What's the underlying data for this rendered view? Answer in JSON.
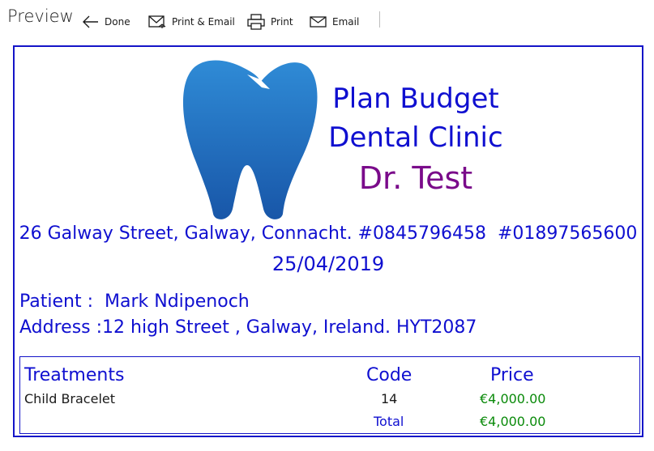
{
  "toolbar": {
    "title": "Preview",
    "done_label": "Done",
    "print_email_label": "Print & Email",
    "print_label": "Print",
    "email_label": "Email"
  },
  "document": {
    "clinic_line1": "Plan Budget",
    "clinic_line2": "Dental Clinic",
    "doctor": "Dr. Test",
    "address": "26 Galway Street, Galway, Connacht. #0845796458  #01897565600",
    "date": "25/04/2019",
    "patient_label": "Patient :",
    "patient_name": "Mark Ndipenoch",
    "address_label": "Address :",
    "patient_address": "12 high Street , Galway, Ireland. HYT2087",
    "table": {
      "headers": {
        "treatments": "Treatments",
        "code": "Code",
        "price": "Price"
      },
      "rows": [
        {
          "treatment": "Child Bracelet",
          "code": "14",
          "price": "€4,000.00"
        }
      ],
      "total_label": "Total",
      "total_value": "€4,000.00"
    }
  },
  "colors": {
    "accent_blue": "#0f0fd0",
    "doctor_purple": "#7a0a8a",
    "price_green": "#0a8a0a",
    "logo_blue": "#1f78c8"
  },
  "icons": [
    "back-arrow-icon",
    "print-email-icon",
    "printer-icon",
    "mail-icon",
    "tooth-logo"
  ]
}
